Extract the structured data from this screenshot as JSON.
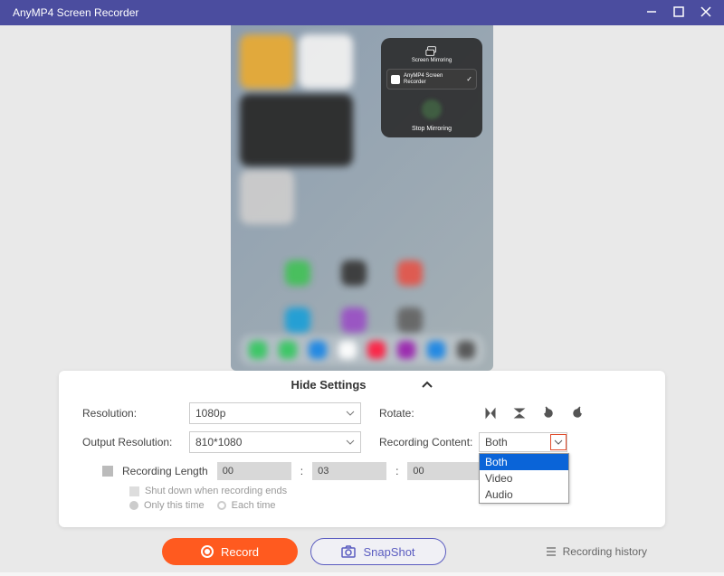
{
  "title": "AnyMP4 Screen Recorder",
  "mirror_panel": {
    "header": "Screen Mirroring",
    "device": "AnyMP4 Screen Recorder",
    "stop": "Stop Mirroring"
  },
  "collapse_label": "Hide Settings",
  "settings": {
    "resolution_label": "Resolution:",
    "resolution_value": "1080p",
    "output_label": "Output Resolution:",
    "output_value": "810*1080",
    "rotate_label": "Rotate:",
    "content_label": "Recording Content:",
    "content_value": "Both",
    "content_options": [
      "Both",
      "Video",
      "Audio"
    ],
    "reclen_label": "Recording Length",
    "time_h": "00",
    "time_m": "03",
    "time_s": "00",
    "shutdown_label": "Shut down when recording ends",
    "only_label": "Only this time",
    "each_label": "Each time"
  },
  "buttons": {
    "record": "Record",
    "snapshot": "SnapShot",
    "history": "Recording history"
  }
}
